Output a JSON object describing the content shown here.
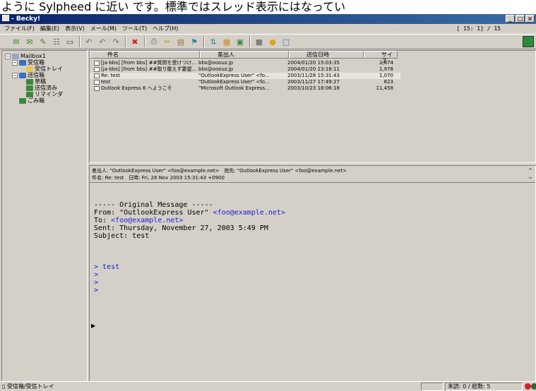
{
  "top_text": "ように Sylpheed に近い です。標準ではスレッド表示にはなってい",
  "window": {
    "title": "- Becky!",
    "controls": [
      "_",
      "□",
      "×"
    ]
  },
  "menu": [
    "ファイル(F)",
    "編集(E)",
    "表示(V)",
    "メール(M)",
    "ツール(T)",
    "ヘルプ(H)"
  ],
  "message_counter": "[   15:  1] / 15",
  "toolbar": {
    "buttons": [
      {
        "icon": "receive-mail-icon",
        "glyph": "✉",
        "color": "#2e8b2e"
      },
      {
        "icon": "send-mail-icon",
        "glyph": "✉",
        "color": "#4a7a1a"
      },
      {
        "icon": "compose-icon",
        "glyph": "✎",
        "color": "#3c8c2c"
      },
      {
        "icon": "address-book-icon",
        "glyph": "☷",
        "color": "#4a6a8a"
      },
      {
        "icon": "tray-icon",
        "glyph": "▭",
        "color": "#4a4a6a"
      },
      {
        "icon": "reply-icon",
        "glyph": "↶",
        "color": "#6a6aa0"
      },
      {
        "icon": "reply-all-icon",
        "glyph": "↶",
        "color": "#6a6aa0"
      },
      {
        "icon": "forward-icon",
        "glyph": "↷",
        "color": "#6a6aa0"
      },
      {
        "icon": "delete-icon",
        "glyph": "✖",
        "color": "#d42020"
      },
      {
        "icon": "print-icon",
        "glyph": "⎙",
        "color": "#6a6a6a"
      },
      {
        "icon": "edit-icon",
        "glyph": "✏",
        "color": "#c8a020"
      },
      {
        "icon": "properties-icon",
        "glyph": "▤",
        "color": "#a07030"
      },
      {
        "icon": "filter-icon",
        "glyph": "⚑",
        "color": "#2a8a9a"
      },
      {
        "icon": "sort-icon",
        "glyph": "⇅",
        "color": "#2a8a9a"
      },
      {
        "icon": "calendar-icon",
        "glyph": "▦",
        "color": "#c89020"
      },
      {
        "icon": "notes-icon",
        "glyph": "▣",
        "color": "#3a8a3a"
      },
      {
        "icon": "lock-icon",
        "glyph": "■",
        "color": "#808080"
      },
      {
        "icon": "globe-icon",
        "glyph": "●",
        "color": "#e0a020"
      },
      {
        "icon": "window-icon",
        "glyph": "□",
        "color": "#4a70b0"
      }
    ]
  },
  "folders": [
    {
      "label": "Mailbox1",
      "indent": 0,
      "expander": "−",
      "icon_color": "#9aa6c0"
    },
    {
      "label": "受信箱",
      "indent": 1,
      "expander": "−",
      "icon_color": "#3a70c0"
    },
    {
      "label": "受信トレイ",
      "indent": 2,
      "expander": "",
      "icon_color": "#e6c850"
    },
    {
      "label": "送信箱",
      "indent": 1,
      "expander": "−",
      "icon_color": "#3a70c0"
    },
    {
      "label": "草稿",
      "indent": 2,
      "expander": "",
      "icon_color": "#3a8a3a"
    },
    {
      "label": "送信済み",
      "indent": 2,
      "expander": "",
      "icon_color": "#3a8a3a"
    },
    {
      "label": "リマインダ",
      "indent": 2,
      "expander": "",
      "icon_color": "#3a8a3a"
    },
    {
      "label": "ごみ箱",
      "indent": 1,
      "expander": "",
      "icon_color": "#3a8a3a"
    }
  ],
  "list": {
    "headers": [
      "件名",
      "差出人",
      "送信日時",
      "サイズ"
    ],
    "rows": [
      {
        "subject": "[ja-bbs] [from bbs] ##質問を受けつけ...",
        "from": "bbs@ooouz.jp",
        "date": "2004/01/20 15:03:35",
        "size": "2,074",
        "selected": false
      },
      {
        "subject": "[ja-bbs] [from bbs] ##取り敢えず要望...",
        "from": "bbs@ooouz.jp",
        "date": "2004/01/20 13:18:11",
        "size": "1,978",
        "selected": false
      },
      {
        "subject": "Re: test",
        "from": "\"OutlookExpress User\" <fo...",
        "date": "2003/11/28 15:31:43",
        "size": "1,070",
        "selected": true
      },
      {
        "subject": "test",
        "from": "\"OutlookExpress User\" <fo...",
        "date": "2003/11/27 17:49:27",
        "size": "823",
        "selected": false
      },
      {
        "subject": "Outlook Express 6 へようこそ",
        "from": "\"Microsoft Outlook Express...",
        "date": "2003/10/23 18:06:18",
        "size": "11,458",
        "selected": false
      }
    ]
  },
  "preview": {
    "from_label": "差出人:",
    "from_value": "\"OutlookExpress User\" <foo@example.net>",
    "to_label": "宛先:",
    "to_value": "\"OutlookExpress User\" <foo@example.net>",
    "subject_label": "件名:",
    "subject_value": "Re: test",
    "date_label": "日時:",
    "date_value": "Fri, 28 Nov 2003 15:31:43 +0900",
    "body": {
      "original": "----- Original Message -----",
      "from_prefix": "From: \"OutlookExpress User\" ",
      "from_addr": "<foo@example.net>",
      "to_prefix": "To: ",
      "to_addr": "<foo@example.net>",
      "sent": "Sent: Thursday, November 27, 2003 5:49 PM",
      "subject": "Subject: test",
      "q1": "> test",
      "q2": ">",
      "q3": ">",
      "q4": ">"
    }
  },
  "status": {
    "left": "受信箱/受信トレイ",
    "counts": "未読:  0 / 総数:  5"
  }
}
